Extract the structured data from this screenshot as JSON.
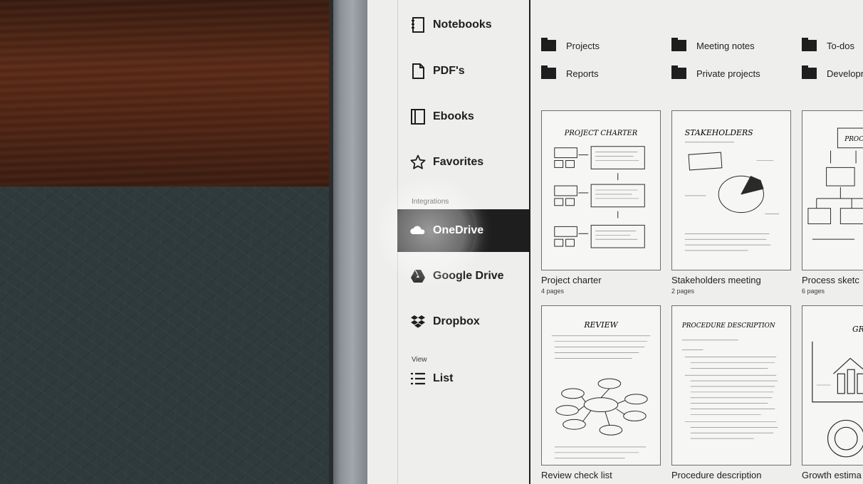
{
  "sidebar": {
    "items": [
      {
        "label": "Notebooks",
        "icon": "notebook-icon"
      },
      {
        "label": "PDF's",
        "icon": "pdf-icon"
      },
      {
        "label": "Ebooks",
        "icon": "ebook-icon"
      },
      {
        "label": "Favorites",
        "icon": "star-icon"
      }
    ],
    "integrations_label": "Integrations",
    "integrations": [
      {
        "label": "OneDrive",
        "icon": "cloud-icon",
        "active": true
      },
      {
        "label": "Google Drive",
        "icon": "google-drive-icon"
      },
      {
        "label": "Dropbox",
        "icon": "dropbox-icon"
      }
    ],
    "view_label": "View",
    "view_option": {
      "label": "List",
      "icon": "list-icon"
    }
  },
  "folders": [
    {
      "label": "Projects"
    },
    {
      "label": "Meeting notes"
    },
    {
      "label": "To-dos"
    },
    {
      "label": "Reports"
    },
    {
      "label": "Private projects"
    },
    {
      "label": "Developr"
    }
  ],
  "documents": [
    {
      "title": "Project charter",
      "pages": "4 pages",
      "heading": "PROJECT CHARTER"
    },
    {
      "title": "Stakeholders meeting",
      "pages": "2 pages",
      "heading": "STAKEHOLDERS"
    },
    {
      "title": "Process sketc",
      "pages": "6 pages",
      "heading": "PROC"
    },
    {
      "title": "Review check list",
      "pages": "",
      "heading": "REVIEW"
    },
    {
      "title": "Procedure description",
      "pages": "",
      "heading": "PROCEDURE DESCRIPTION"
    },
    {
      "title": "Growth estima",
      "pages": "",
      "heading": "GROWTH"
    }
  ]
}
